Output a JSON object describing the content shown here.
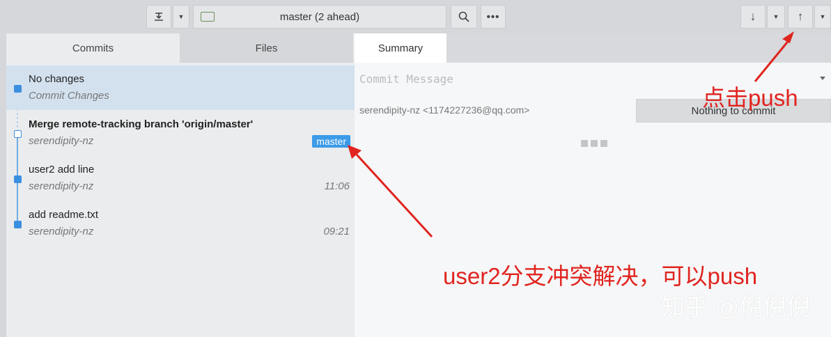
{
  "toolbar": {
    "branch_label": "master (2 ahead)"
  },
  "tabs": {
    "commits": "Commits",
    "files": "Files",
    "summary": "Summary"
  },
  "commits": [
    {
      "message": "No changes",
      "author": "Commit Changes",
      "time": "",
      "badge": ""
    },
    {
      "message": "Merge remote-tracking branch 'origin/master'",
      "author": "serendipity-nz",
      "time": "",
      "badge": "master"
    },
    {
      "message": "user2 add line",
      "author": "serendipity-nz",
      "time": "11:06",
      "badge": ""
    },
    {
      "message": "add readme.txt",
      "author": "serendipity-nz",
      "time": "09:21",
      "badge": ""
    }
  ],
  "summary": {
    "commit_message_placeholder": "Commit Message",
    "identity": "serendipity-nz <1174227236@qq.com>",
    "commit_button": "Nothing to commit"
  },
  "annotations": {
    "push_hint": "点击push",
    "resolved_hint": "user2分支冲突解决，可以push",
    "watermark": "知乎 @倪倪倪"
  },
  "colors": {
    "accent": "#3b8fe0",
    "annotation": "#e0241f"
  }
}
